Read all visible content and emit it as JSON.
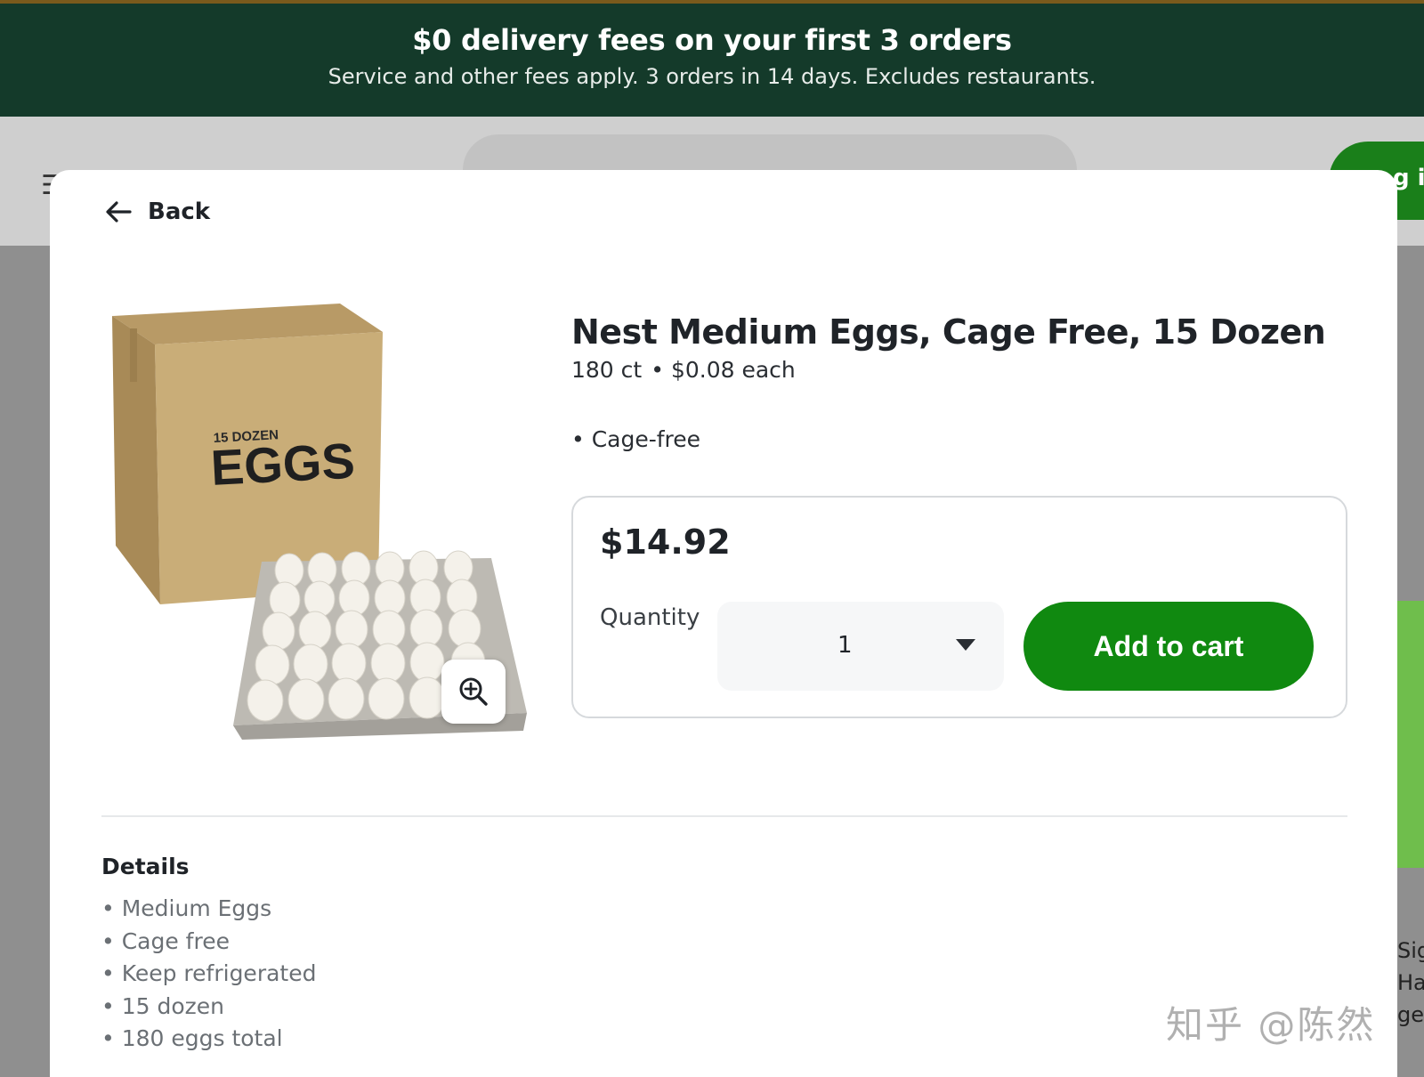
{
  "promo": {
    "title": "$0 delivery fees on your first 3 orders",
    "subtitle": "Service and other fees apply. 3 orders in 14 days. Excludes restaurants."
  },
  "background": {
    "login_fragment": "g i",
    "peek_text": [
      "Sig",
      "Ha",
      "ge"
    ]
  },
  "modal": {
    "back_label": "Back",
    "product": {
      "title": "Nest Medium Eggs, Cage Free, 15 Dozen",
      "count": "180 ct",
      "unit_price": "$0.08 each",
      "highlight": "• Cage-free",
      "image_box_text_top": "15 DOZEN",
      "image_box_text_main": "EGGS"
    },
    "purchase": {
      "price": "$14.92",
      "quantity_label": "Quantity",
      "quantity_value": "1",
      "add_to_cart": "Add to cart"
    },
    "details": {
      "title": "Details",
      "items": [
        "Medium Eggs",
        "Cage free",
        "Keep refrigerated",
        "15 dozen",
        "180 eggs total"
      ]
    }
  },
  "watermark": "知乎 @陈然",
  "colors": {
    "promo_bg": "#143a2a",
    "brand_green": "#108910",
    "overlay": "#8f8f8f"
  },
  "icons": {
    "back": "arrow-left-icon",
    "zoom": "zoom-in-icon",
    "dropdown": "caret-down-icon"
  }
}
